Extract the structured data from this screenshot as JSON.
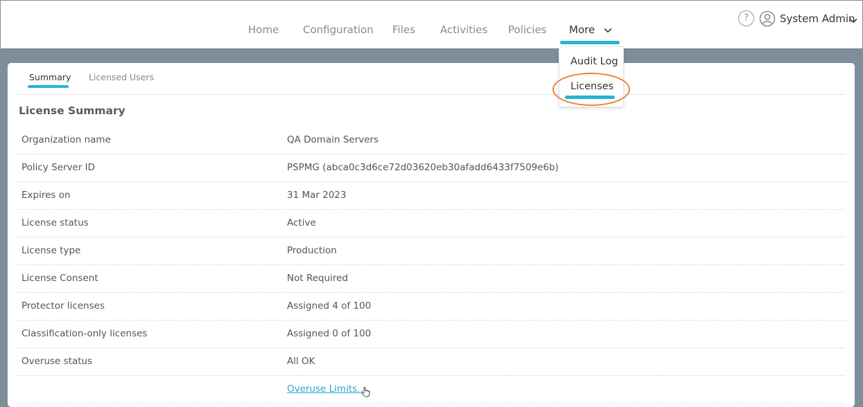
{
  "nav": {
    "items": [
      {
        "label": "Home"
      },
      {
        "label": "Configuration"
      },
      {
        "label": "Files"
      },
      {
        "label": "Activities"
      },
      {
        "label": "Policies"
      },
      {
        "label": "More"
      }
    ],
    "active": "More"
  },
  "user": {
    "help_glyph": "?",
    "name": "System Admin"
  },
  "more_menu": {
    "items": [
      {
        "label": "Audit Log"
      },
      {
        "label": "Licenses"
      }
    ],
    "highlighted": "Licenses"
  },
  "tabs": [
    {
      "label": "Summary"
    },
    {
      "label": "Licensed Users"
    }
  ],
  "summary": {
    "title": "License Summary",
    "rows": [
      {
        "label": "Organization name",
        "value": "QA Domain Servers"
      },
      {
        "label": "Policy Server ID",
        "value": "PSPMG (abca0c3d6ce72d03620eb30afadd6433f7509e6b)"
      },
      {
        "label": "Expires on",
        "value": "31 Mar 2023"
      },
      {
        "label": "License status",
        "value": "Active"
      },
      {
        "label": "License type",
        "value": "Production"
      },
      {
        "label": "License Consent",
        "value": "Not Required"
      },
      {
        "label": "Protector licenses",
        "value": "Assigned 4 of 100"
      },
      {
        "label": "Classification-only licenses",
        "value": "Assigned 0 of 100"
      },
      {
        "label": "Overuse status",
        "value": "All OK"
      }
    ],
    "overuse_link": "Overuse Limits..."
  },
  "colors": {
    "accent": "#27b3d7",
    "highlight_ring": "#e8803a",
    "link": "#27a6d4",
    "backdrop": "#7d8e9b"
  }
}
